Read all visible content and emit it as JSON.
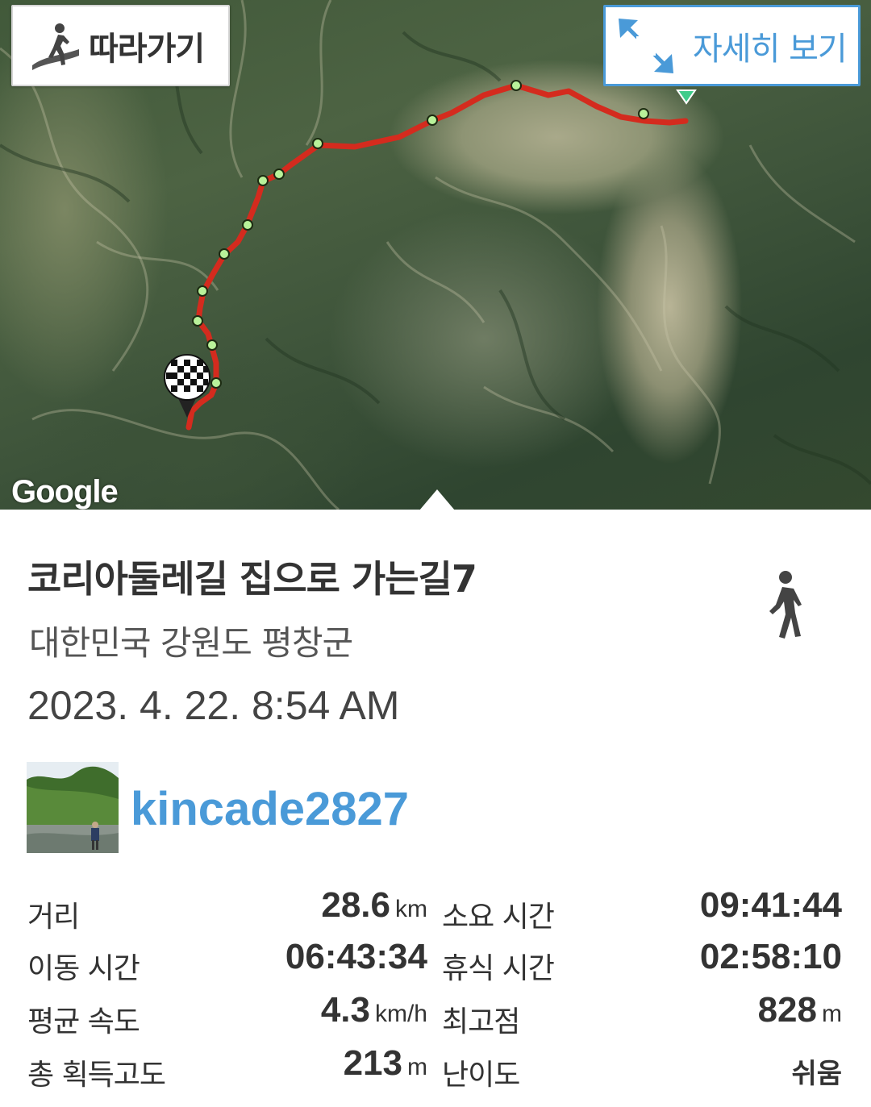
{
  "map": {
    "follow_label": "따라가기",
    "detail_label": "자세히 보기",
    "provider_logo": "Google",
    "route_color": "#d42b1e",
    "waypoint_color": "#b9f29a",
    "icons": {
      "follow": "hiker-icon",
      "detail": "expand-arrows-icon",
      "finish": "checkered-flag-icon",
      "start": "start-marker-icon"
    }
  },
  "track": {
    "title": "코리아둘레길 집으로 가는길7",
    "location": "대한민국 강원도 평창군",
    "datetime": "2023. 4. 22. 8:54 AM",
    "activity_icon": "walking-person-icon",
    "user": {
      "name": "kincade2827",
      "avatar": "avatar-photo"
    }
  },
  "stats": {
    "rows": [
      {
        "label": "거리",
        "value": "28.6",
        "unit": "km",
        "label2": "소요 시간",
        "value2": "09:41:44",
        "unit2": ""
      },
      {
        "label": "이동 시간",
        "value": "06:43:34",
        "unit": "",
        "label2": "휴식 시간",
        "value2": "02:58:10",
        "unit2": ""
      },
      {
        "label": "평균 속도",
        "value": "4.3",
        "unit": "km/h",
        "label2": "최고점",
        "value2": "828",
        "unit2": "m"
      },
      {
        "label": "총 획득고도",
        "value": "213",
        "unit": "m",
        "label2": "난이도",
        "value2": "쉬움",
        "unit2": ""
      }
    ]
  },
  "colors": {
    "accent": "#4a9ad8",
    "text": "#333333"
  }
}
